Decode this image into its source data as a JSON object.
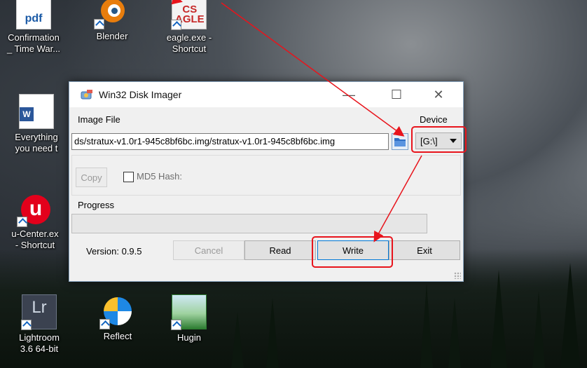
{
  "desktop": {
    "icons": [
      {
        "label": "Confirmation\n_ Time War...",
        "name": "pdf-file",
        "badge": "pdf"
      },
      {
        "label": "Blender",
        "name": "blender"
      },
      {
        "label": "eagle.exe -\nShortcut",
        "name": "eagle",
        "badge": "CS\nAGLE"
      },
      {
        "label": "Everything\nyou need t",
        "name": "word-doc",
        "badge": "W"
      },
      {
        "label": "u-Center.ex\n- Shortcut",
        "name": "u-center",
        "badge": "u"
      },
      {
        "label": "Lightroom\n3.6 64-bit",
        "name": "lightroom",
        "badge": "Lr"
      },
      {
        "label": "Reflect",
        "name": "reflect"
      },
      {
        "label": "Hugin",
        "name": "hugin"
      }
    ]
  },
  "window": {
    "title": "Win32 Disk Imager",
    "minimize_glyph": "—",
    "maximize_glyph": "☐",
    "close_glyph": "✕",
    "image_file_label": "Image File",
    "image_path": "ds/stratux-v1.0r1-945c8bf6bc.img/stratux-v1.0r1-945c8bf6bc.img",
    "device_label": "Device",
    "device_value": "[G:\\]",
    "copy_label": "Copy",
    "md5_label": "MD5 Hash:",
    "progress_label": "Progress",
    "progress_value": 0,
    "version": "Version: 0.9.5",
    "buttons": {
      "cancel": "Cancel",
      "read": "Read",
      "write": "Write",
      "exit": "Exit"
    }
  },
  "annotations": {
    "color": "#e8141c"
  }
}
